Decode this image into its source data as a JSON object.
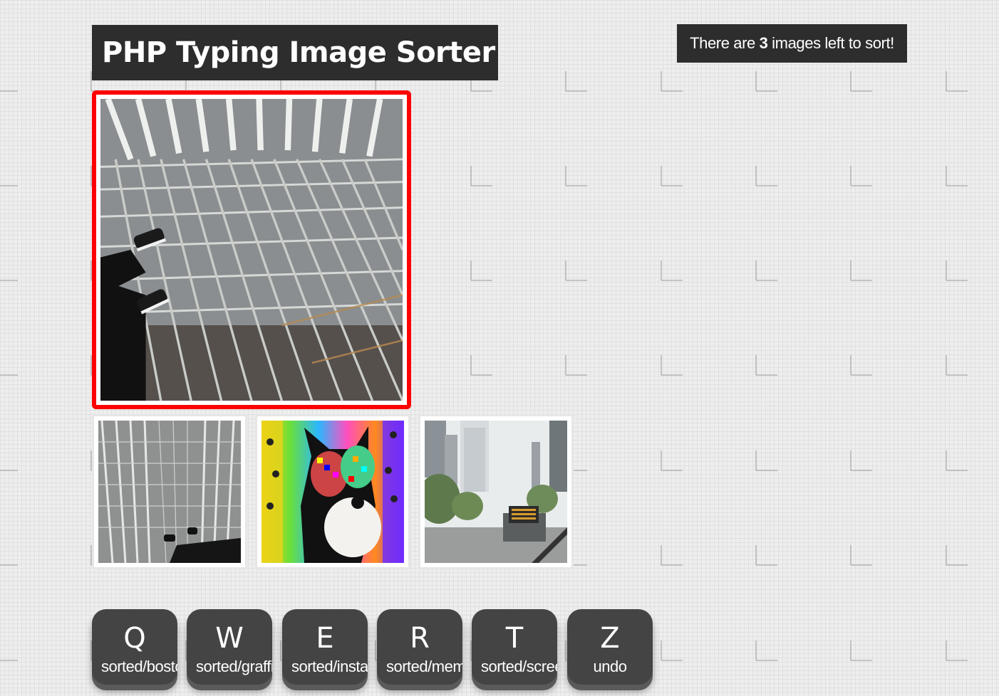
{
  "app": {
    "title": "PHP Typing Image Sorter"
  },
  "counter": {
    "prefix": "There are ",
    "count": "3",
    "suffix": " images left to sort!"
  },
  "queue": [
    {
      "name": "rooftop-fire-escape"
    },
    {
      "name": "felix-cat-collage"
    },
    {
      "name": "city-street-underpass"
    }
  ],
  "keys": [
    {
      "letter": "Q",
      "label": "sorted/boston"
    },
    {
      "letter": "W",
      "label": "sorted/graffiti"
    },
    {
      "letter": "E",
      "label": "sorted/instagram"
    },
    {
      "letter": "R",
      "label": "sorted/memes"
    },
    {
      "letter": "T",
      "label": "sorted/screenshots"
    },
    {
      "letter": "Z",
      "label": "undo"
    }
  ],
  "colors": {
    "panel": "#2d2d2d",
    "selected_border": "#ff0000",
    "key": "#444444"
  }
}
